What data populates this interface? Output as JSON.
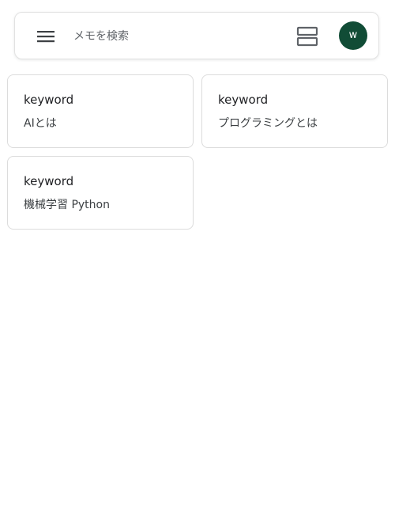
{
  "search": {
    "placeholder": "メモを検索",
    "menu_icon": "menu-icon",
    "layout_icon": "list-view-icon"
  },
  "account": {
    "avatar_letter": "w",
    "avatar_color": "#114c36"
  },
  "notes": [
    {
      "title": "keyword",
      "body": "AIとは"
    },
    {
      "title": "keyword",
      "body": "プログラミングとは"
    },
    {
      "title": "keyword",
      "body": "機械学習 Python"
    }
  ]
}
